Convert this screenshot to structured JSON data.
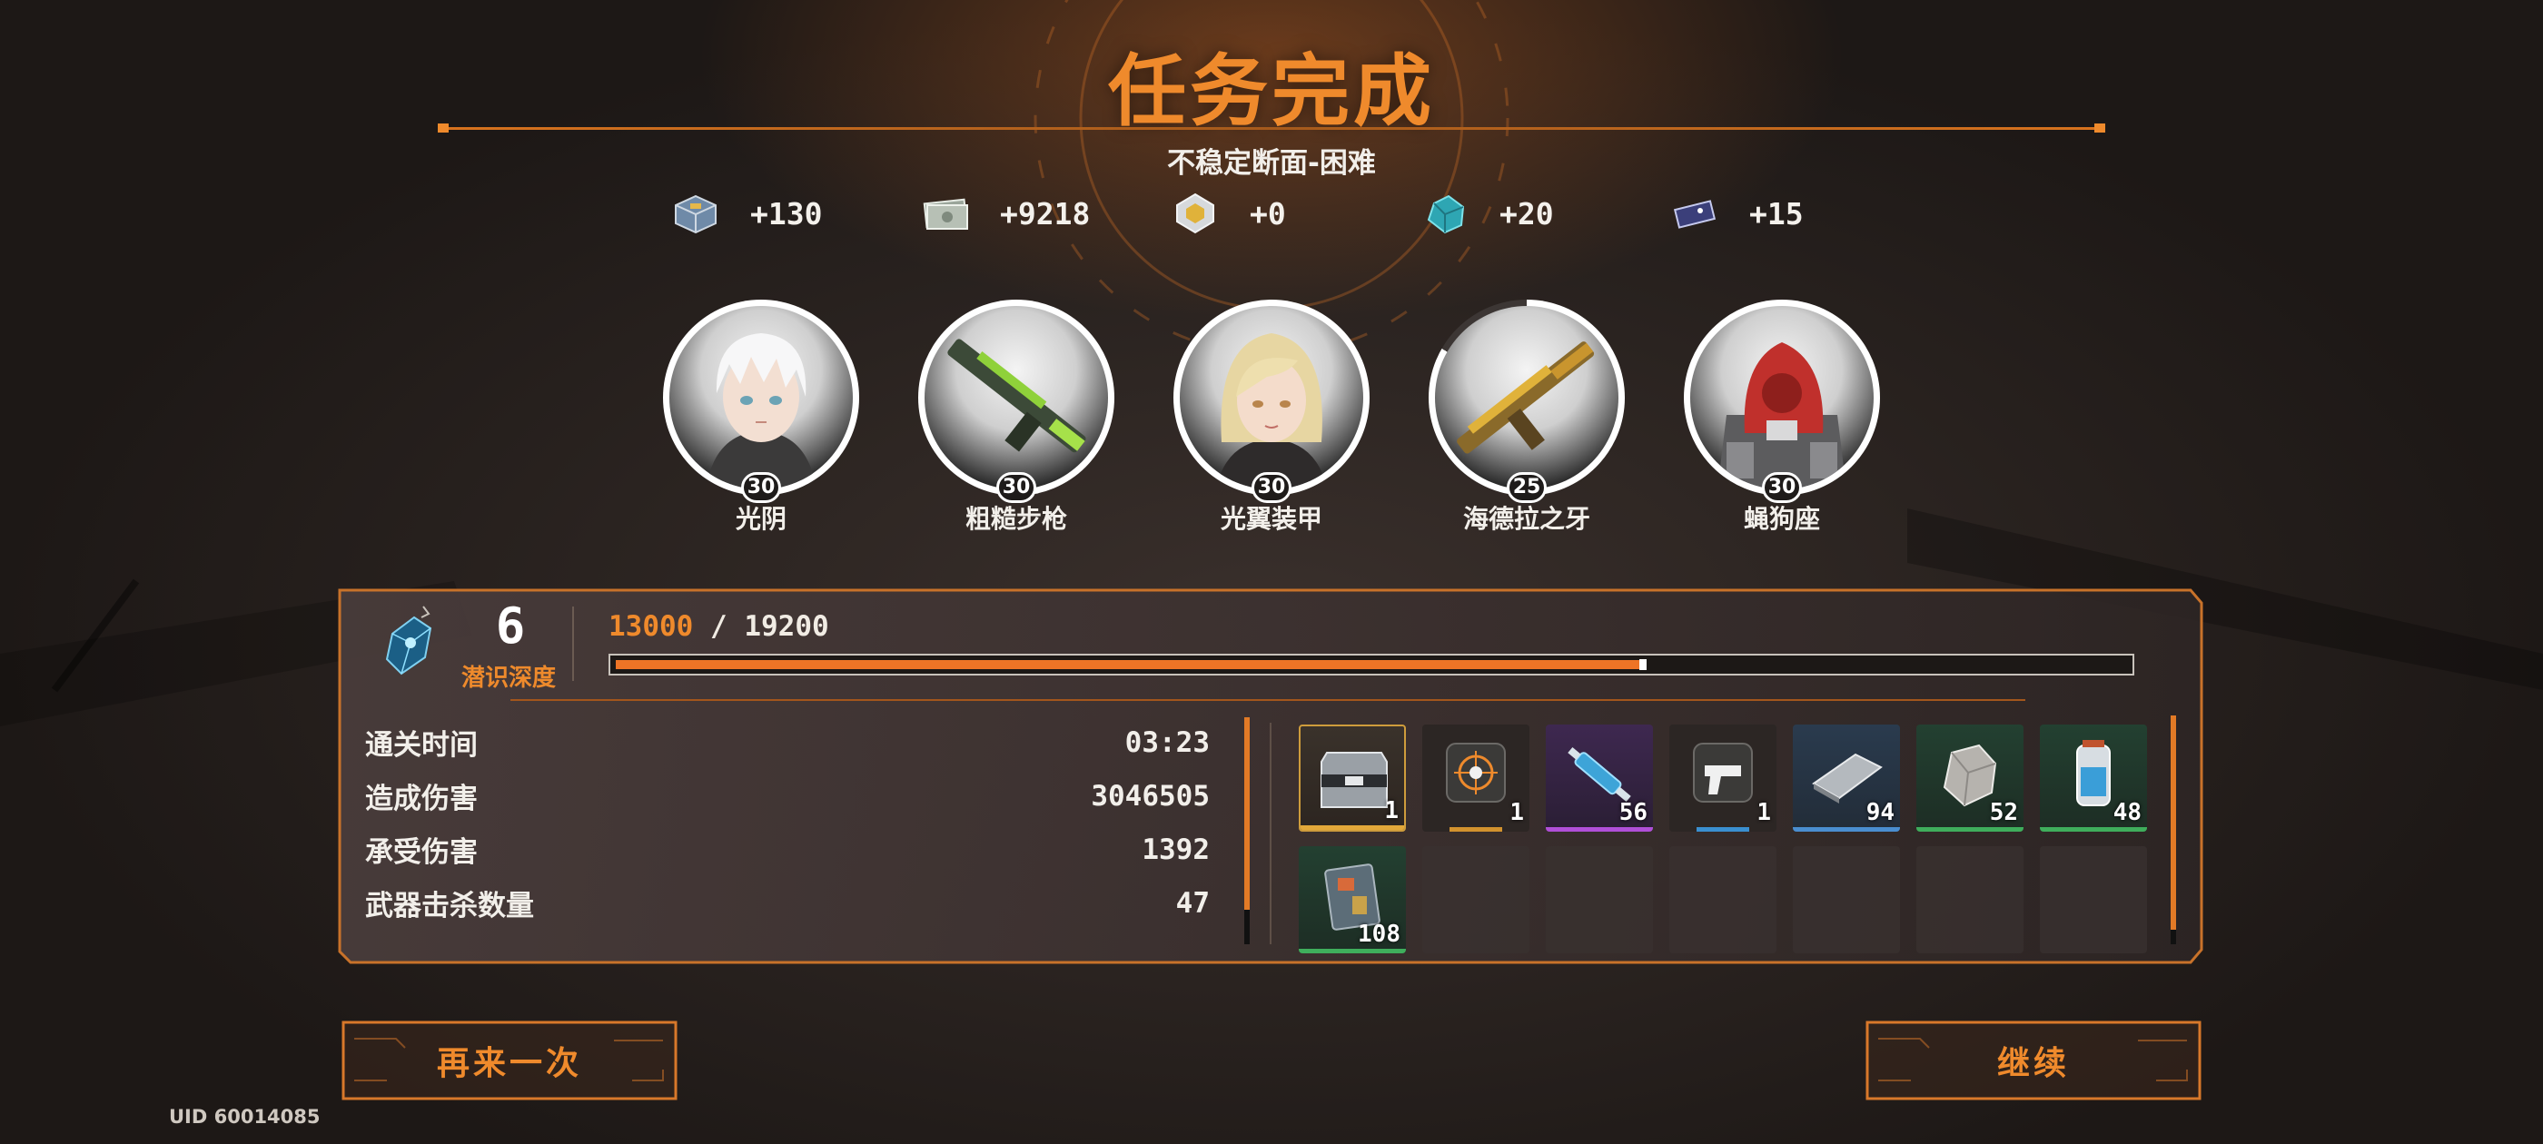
{
  "title": "任务完成",
  "subtitle": "不稳定断面-困难",
  "rewards": [
    {
      "icon": "supply-crate-icon",
      "value": "+130"
    },
    {
      "icon": "banknotes-icon",
      "value": "+9218"
    },
    {
      "icon": "gold-crystal-icon",
      "value": "+0"
    },
    {
      "icon": "teal-ore-icon",
      "value": "+20"
    },
    {
      "icon": "ticket-card-icon",
      "value": "+15"
    }
  ],
  "team": [
    {
      "name": "光阴",
      "level": "30",
      "portrait": "white-haired-character-portrait"
    },
    {
      "name": "粗糙步枪",
      "level": "30",
      "portrait": "green-rifle-portrait"
    },
    {
      "name": "光翼装甲",
      "level": "30",
      "portrait": "blonde-character-portrait"
    },
    {
      "name": "海德拉之牙",
      "level": "25",
      "portrait": "gold-shotgun-portrait"
    },
    {
      "name": "蝇狗座",
      "level": "30",
      "portrait": "red-mech-portrait"
    }
  ],
  "depth": {
    "value": "6",
    "label": "潜识深度",
    "icon": "crystal-pendant-icon"
  },
  "xp": {
    "current": "13000",
    "separator": " / ",
    "max": "19200",
    "fraction": 0.677
  },
  "stats": [
    {
      "label": "通关时间",
      "value": "03:23"
    },
    {
      "label": "造成伤害",
      "value": "3046505"
    },
    {
      "label": "承受伤害",
      "value": "1392"
    },
    {
      "label": "武器击杀数量",
      "value": "47"
    }
  ],
  "items": [
    {
      "icon": "metal-crate-icon",
      "qty": "1",
      "rarity": "gold"
    },
    {
      "icon": "target-module-icon",
      "qty": "1",
      "rarity": "dark"
    },
    {
      "icon": "syringe-icon",
      "qty": "56",
      "rarity": "purple"
    },
    {
      "icon": "pistol-part-icon",
      "qty": "1",
      "rarity": "dark"
    },
    {
      "icon": "metal-plate-icon",
      "qty": "94",
      "rarity": "blue"
    },
    {
      "icon": "stone-ore-icon",
      "qty": "52",
      "rarity": "green"
    },
    {
      "icon": "canister-icon",
      "qty": "48",
      "rarity": "green"
    },
    {
      "icon": "circuit-board-icon",
      "qty": "108",
      "rarity": "green"
    }
  ],
  "empty_slots": 6,
  "buttons": {
    "retry": "再来一次",
    "continue": "继续"
  },
  "uid": "UID 60014085",
  "colors": {
    "accent": "#ef8a2c",
    "xp_fill": "#ee7426",
    "panel_border": "#c8722a"
  }
}
